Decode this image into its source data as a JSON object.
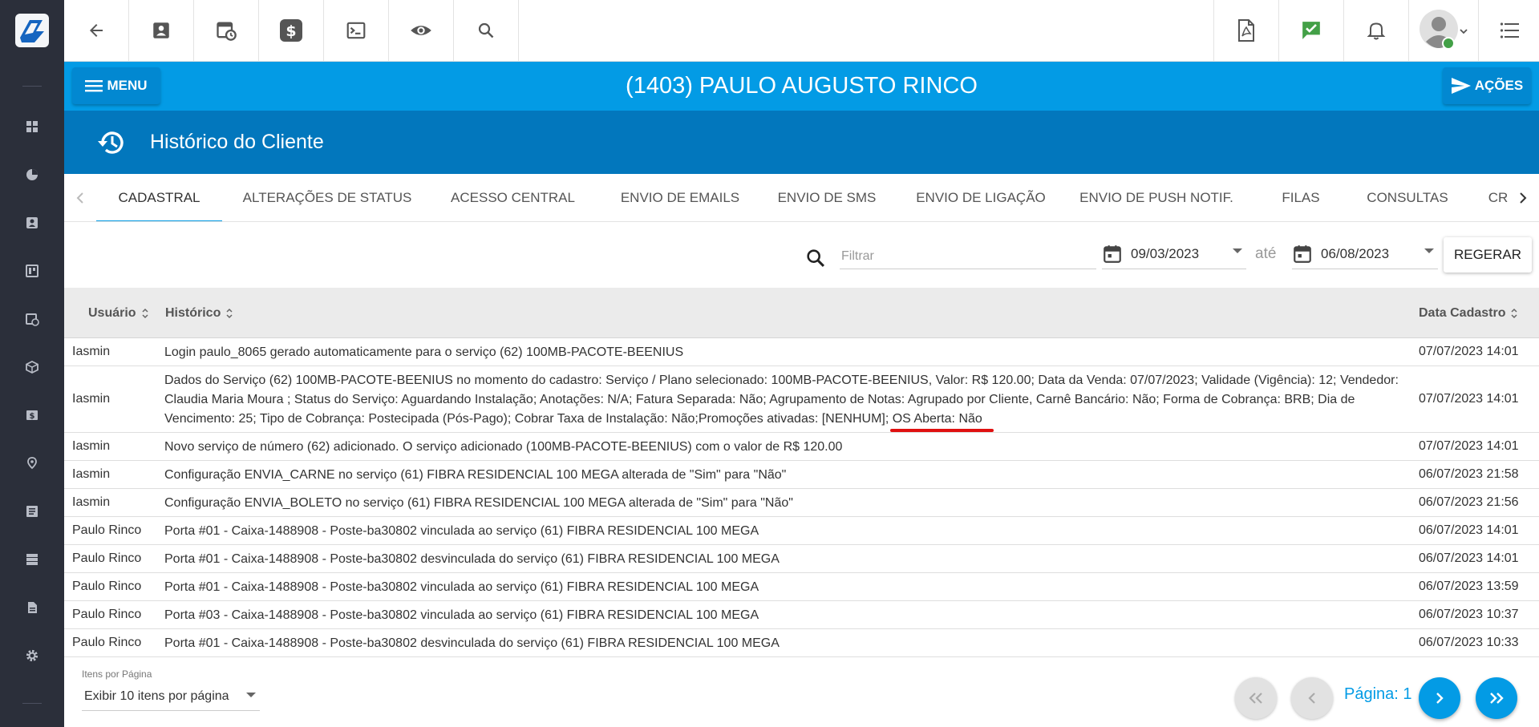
{
  "client_bar": {
    "menu_label": "MENU",
    "client_title": "(1403) PAULO AUGUSTO RINCO",
    "actions_label": "AÇÕES"
  },
  "section": {
    "title": "Histórico do Cliente"
  },
  "tabs": [
    {
      "label": "CADASTRAL",
      "active": true
    },
    {
      "label": "ALTERAÇÕES DE STATUS"
    },
    {
      "label": "ACESSO CENTRAL"
    },
    {
      "label": "ENVIO DE EMAILS"
    },
    {
      "label": "ENVIO DE SMS"
    },
    {
      "label": "ENVIO DE LIGAÇÃO"
    },
    {
      "label": "ENVIO DE PUSH NOTIF."
    },
    {
      "label": "FILAS"
    },
    {
      "label": "CONSULTAS"
    },
    {
      "label": "CR"
    }
  ],
  "filter": {
    "placeholder": "Filtrar",
    "date_from": "09/03/2023",
    "range_separator": "até",
    "date_to": "06/08/2023",
    "regenerate_label": "REGERAR"
  },
  "table": {
    "headers": {
      "user": "Usuário",
      "history": "Histórico",
      "date": "Data Cadastro"
    },
    "rows": [
      {
        "user": "Iasmin",
        "history": "Login paulo_8065 gerado automaticamente para o serviço (62) 100MB-PACOTE-BEENIUS",
        "date": "07/07/2023 14:01"
      },
      {
        "user": "Iasmin",
        "history": "Dados do Serviço (62) 100MB-PACOTE-BEENIUS no momento do cadastro: Serviço / Plano selecionado: 100MB-PACOTE-BEENIUS, Valor: R$ 120.00; Data da Venda: 07/07/2023; Validade (Vigência): 12; Vendedor: Claudia Maria Moura ; Status do Serviço: Aguardando Instalação; Anotações: N/A; Fatura Separada: Não; Agrupamento de Notas: Agrupado por Cliente, Carnê Bancário: Não; Forma de Cobrança: BRB; Dia de Vencimento: 25; Tipo de Cobrança: Postecipada (Pós-Pago); Cobrar Taxa de Instalação: Não;Promoções ativadas: [NENHUM]",
        "history_tail": "; OS Aberta: Não",
        "date": "07/07/2023 14:01"
      },
      {
        "user": "Iasmin",
        "history": "Novo serviço de número (62) adicionado. O serviço adicionado (100MB-PACOTE-BEENIUS) com o valor de R$ 120.00",
        "date": "07/07/2023 14:01"
      },
      {
        "user": "Iasmin",
        "history": "Configuração ENVIA_CARNE no serviço (61) FIBRA RESIDENCIAL 100 MEGA alterada de \"Sim\" para \"Não\"",
        "date": "06/07/2023 21:58"
      },
      {
        "user": "Iasmin",
        "history": "Configuração ENVIA_BOLETO no serviço (61) FIBRA RESIDENCIAL 100 MEGA alterada de \"Sim\" para \"Não\"",
        "date": "06/07/2023 21:56"
      },
      {
        "user": "Paulo Rinco",
        "history": "Porta #01 - Caixa-1488908 - Poste-ba30802 vinculada ao serviço (61) FIBRA RESIDENCIAL 100 MEGA",
        "date": "06/07/2023 14:01"
      },
      {
        "user": "Paulo Rinco",
        "history": "Porta #01 - Caixa-1488908 - Poste-ba30802 desvinculada do serviço (61) FIBRA RESIDENCIAL 100 MEGA",
        "date": "06/07/2023 14:01"
      },
      {
        "user": "Paulo Rinco",
        "history": "Porta #01 - Caixa-1488908 - Poste-ba30802 vinculada ao serviço (61) FIBRA RESIDENCIAL 100 MEGA",
        "date": "06/07/2023 13:59"
      },
      {
        "user": "Paulo Rinco",
        "history": "Porta #03 - Caixa-1488908 - Poste-ba30802 vinculada ao serviço (61) FIBRA RESIDENCIAL 100 MEGA",
        "date": "06/07/2023 10:37"
      },
      {
        "user": "Paulo Rinco",
        "history": "Porta #01 - Caixa-1488908 - Poste-ba30802 desvinculada do serviço (61) FIBRA RESIDENCIAL 100 MEGA",
        "date": "06/07/2023 10:33"
      }
    ]
  },
  "pagination": {
    "items_per_page_label": "Itens por Página",
    "items_per_page_value": "Exibir 10 itens por página",
    "page_label": "Página: 1"
  },
  "colors": {
    "sidebar": "#2b2f3a",
    "client_bar": "#039be5",
    "section_header": "#0277bd",
    "accent": "#039be5",
    "underline_mark": "#e01010",
    "status_check": "#43a047"
  },
  "icons": {
    "toolbar": [
      "arrow-back-icon",
      "contact-card-icon",
      "calendar-clock-icon",
      "dollar-icon",
      "terminal-icon",
      "eye-icon",
      "search-icon",
      "pdf-icon",
      "check-message-icon",
      "bell-icon",
      "user-avatar",
      "list-icon"
    ],
    "sidebar": [
      "dashboard-icon",
      "pie-chart-icon",
      "contact-card-icon",
      "board-icon",
      "calendar-clock-icon",
      "box-icon",
      "money-icon",
      "map-pin-icon",
      "document-list-icon",
      "server-icon",
      "file-icon",
      "gear-icon"
    ]
  }
}
